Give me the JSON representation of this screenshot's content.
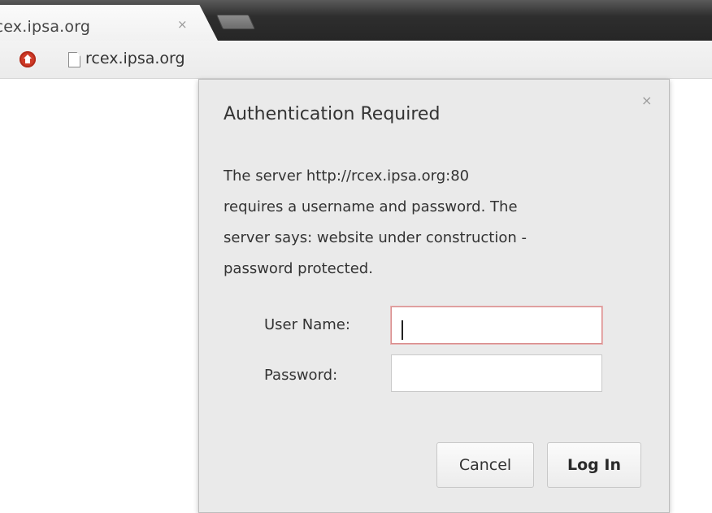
{
  "browser": {
    "tab": {
      "title": "rcex.ipsa.org",
      "close_glyph": "×"
    },
    "toolbar": {
      "home_icon": "home-icon",
      "page_icon": "page-icon",
      "url": "rcex.ipsa.org"
    }
  },
  "dialog": {
    "close_glyph": "×",
    "title": "Authentication Required",
    "message_lines": [
      "The server http://rcex.ipsa.org:80",
      "requires a username and password. The",
      "server says: website under construction -",
      "password protected."
    ],
    "username_label": "User Name:",
    "username_value": "",
    "password_label": "Password:",
    "password_value": "",
    "cancel_label": "Cancel",
    "login_label": "Log In"
  },
  "colors": {
    "tabstrip": "#2e2e2e",
    "dialog_bg": "#eaeaea",
    "focus_border": "#d98c8c",
    "home_icon": "#cf3a27"
  }
}
